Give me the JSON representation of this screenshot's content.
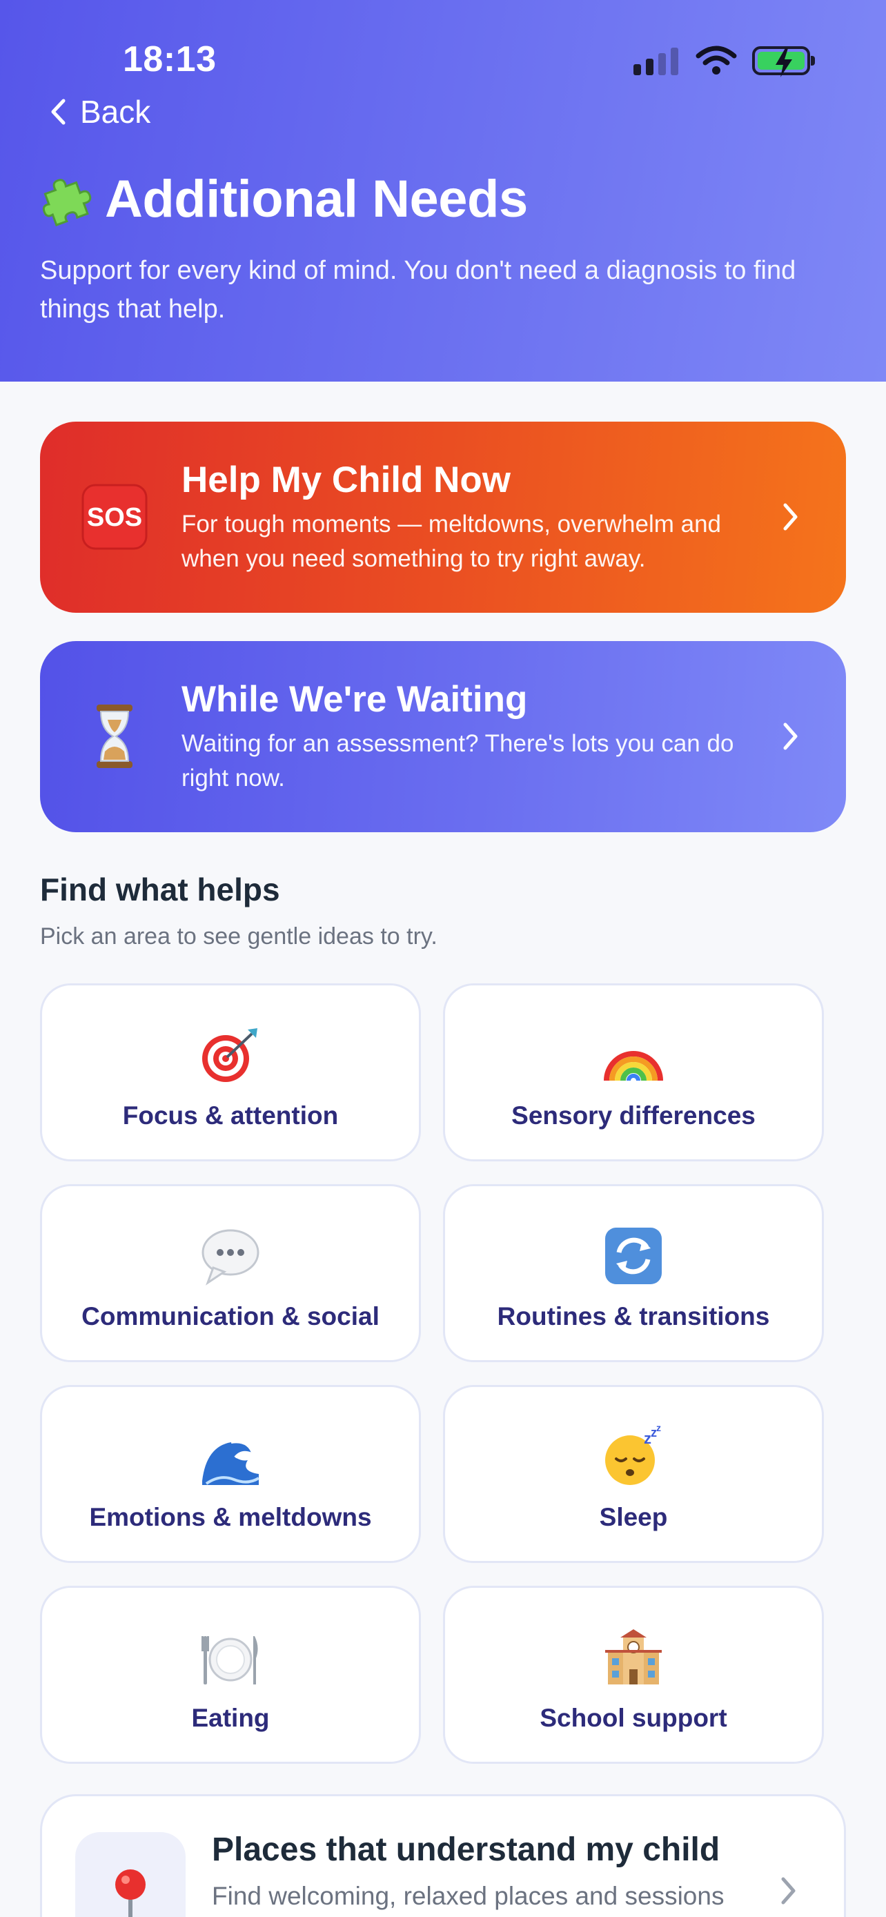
{
  "status_bar": {
    "time": "18:13"
  },
  "header": {
    "back_label": "Back",
    "title": "Additional Needs",
    "title_icon": "puzzle-piece-icon",
    "subtitle": "Support for every kind of mind. You don't need a diagnosis to find things that help."
  },
  "hero_cards": [
    {
      "title": "Help My Child Now",
      "description": "For tough moments — meltdowns, overwhelm and when you need something to try right away.",
      "icon": "sos-icon"
    },
    {
      "title": "While We're Waiting",
      "description": "Waiting for an assessment? There's lots you can do right now.",
      "icon": "hourglass-icon"
    }
  ],
  "find_section": {
    "title": "Find what helps",
    "subtitle": "Pick an area to see gentle ideas to try."
  },
  "tiles": [
    {
      "label": "Focus & attention",
      "icon": "target-icon"
    },
    {
      "label": "Sensory differences",
      "icon": "rainbow-icon"
    },
    {
      "label": "Communication & social",
      "icon": "speech-bubble-icon"
    },
    {
      "label": "Routines & transitions",
      "icon": "repeat-arrows-icon"
    },
    {
      "label": "Emotions & meltdowns",
      "icon": "wave-icon"
    },
    {
      "label": "Sleep",
      "icon": "sleepy-face-icon"
    },
    {
      "label": "Eating",
      "icon": "plate-cutlery-icon"
    },
    {
      "label": "School support",
      "icon": "school-icon"
    }
  ],
  "places_card": {
    "title": "Places that understand my child",
    "description": "Find welcoming, relaxed places and sessions",
    "icon": "pin-icon"
  },
  "colors": {
    "header_gradient_start": "#5656ea",
    "header_gradient_end": "#7f88f6",
    "sos_gradient_start": "#df2d2a",
    "sos_gradient_end": "#f5741b",
    "tile_label": "#2d2b7a",
    "page_background": "#f7f8fb"
  }
}
